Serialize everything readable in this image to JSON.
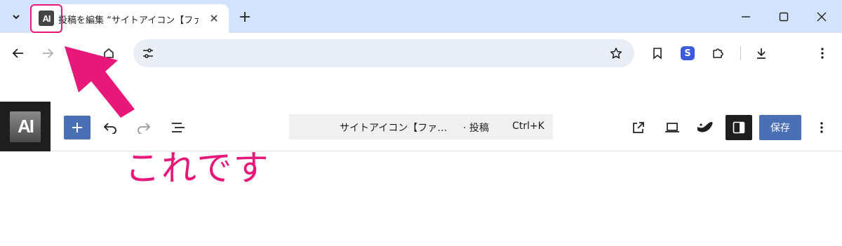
{
  "browser": {
    "tab": {
      "favicon_text": "AI",
      "title": "投稿を編集 “サイトアイコン【ファビコ"
    },
    "toolbar": {
      "url": ""
    }
  },
  "editor": {
    "logo_text": "AI",
    "command_bar": {
      "title": "サイトアイコン【ファ…",
      "type": "· 投稿",
      "shortcut": "Ctrl+K"
    },
    "save_label": "保存"
  },
  "annotation": {
    "text": "これです",
    "color": "#e8177a"
  },
  "colors": {
    "tabstrip_bg": "#d3e3fd",
    "omnibox_bg": "#e9eef6",
    "wp_primary": "#4a6fb5",
    "wp_dark": "#1e1e1e"
  }
}
